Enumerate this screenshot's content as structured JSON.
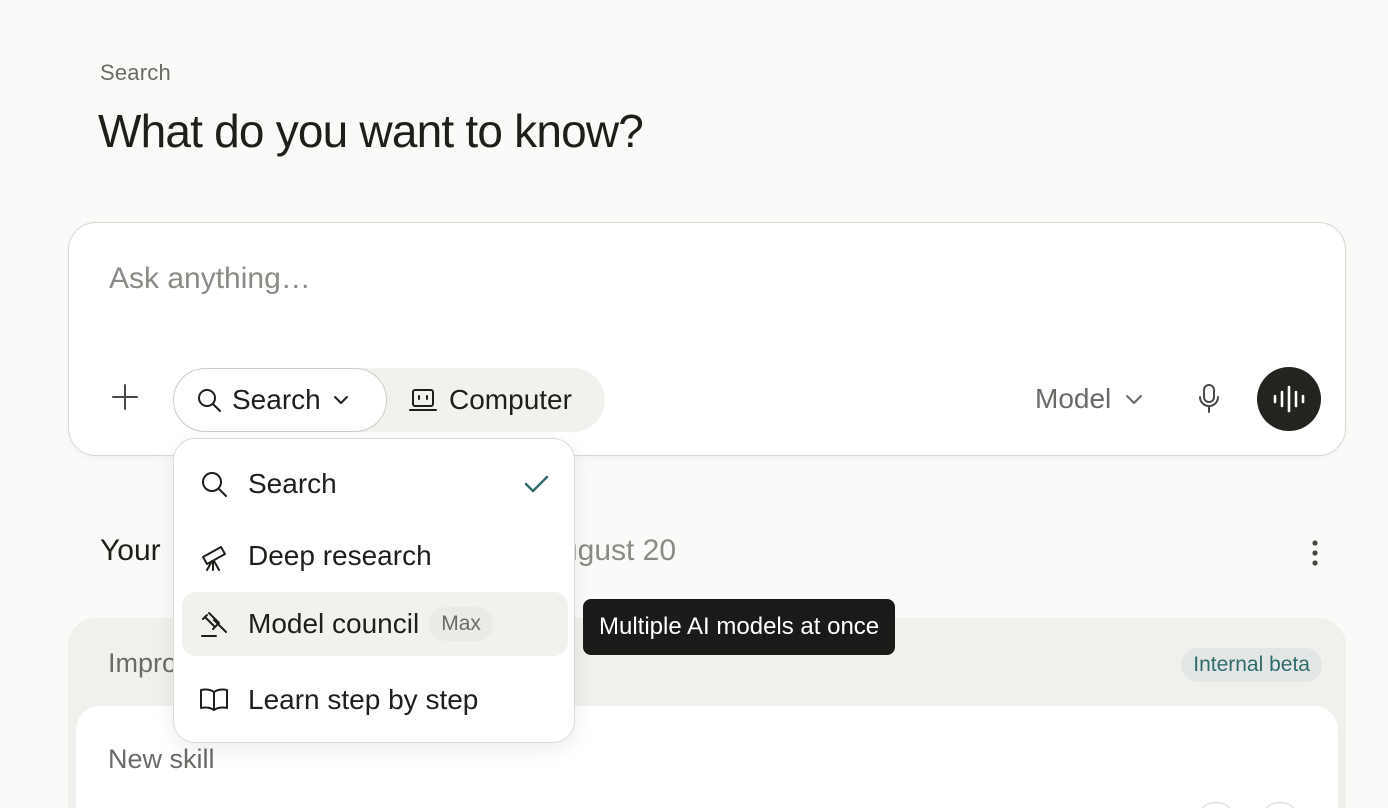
{
  "header": {
    "breadcrumb": "Search",
    "title": "What do you want to know?"
  },
  "composer": {
    "placeholder": "Ask anything…",
    "modes": {
      "search_label": "Search",
      "computer_label": "Computer"
    },
    "model_label": "Model"
  },
  "dropdown": {
    "items": [
      {
        "label": "Search",
        "icon": "search-icon",
        "selected": true
      },
      {
        "label": "Deep research",
        "icon": "telescope-icon"
      },
      {
        "label": "Model council",
        "icon": "gavel-icon",
        "badge": "Max"
      },
      {
        "label": "Learn step by step",
        "icon": "book-icon"
      }
    ],
    "tooltip": "Multiple AI models at once"
  },
  "section": {
    "heading_start": "Your ",
    "heading_date": "ugust 20"
  },
  "card": {
    "title": "Impro",
    "badge": "Internal beta",
    "inner_title": "New skill"
  },
  "colors": {
    "background": "#fbfaf8",
    "accent_teal": "#2f6b6a",
    "voice_button": "#25231f"
  }
}
